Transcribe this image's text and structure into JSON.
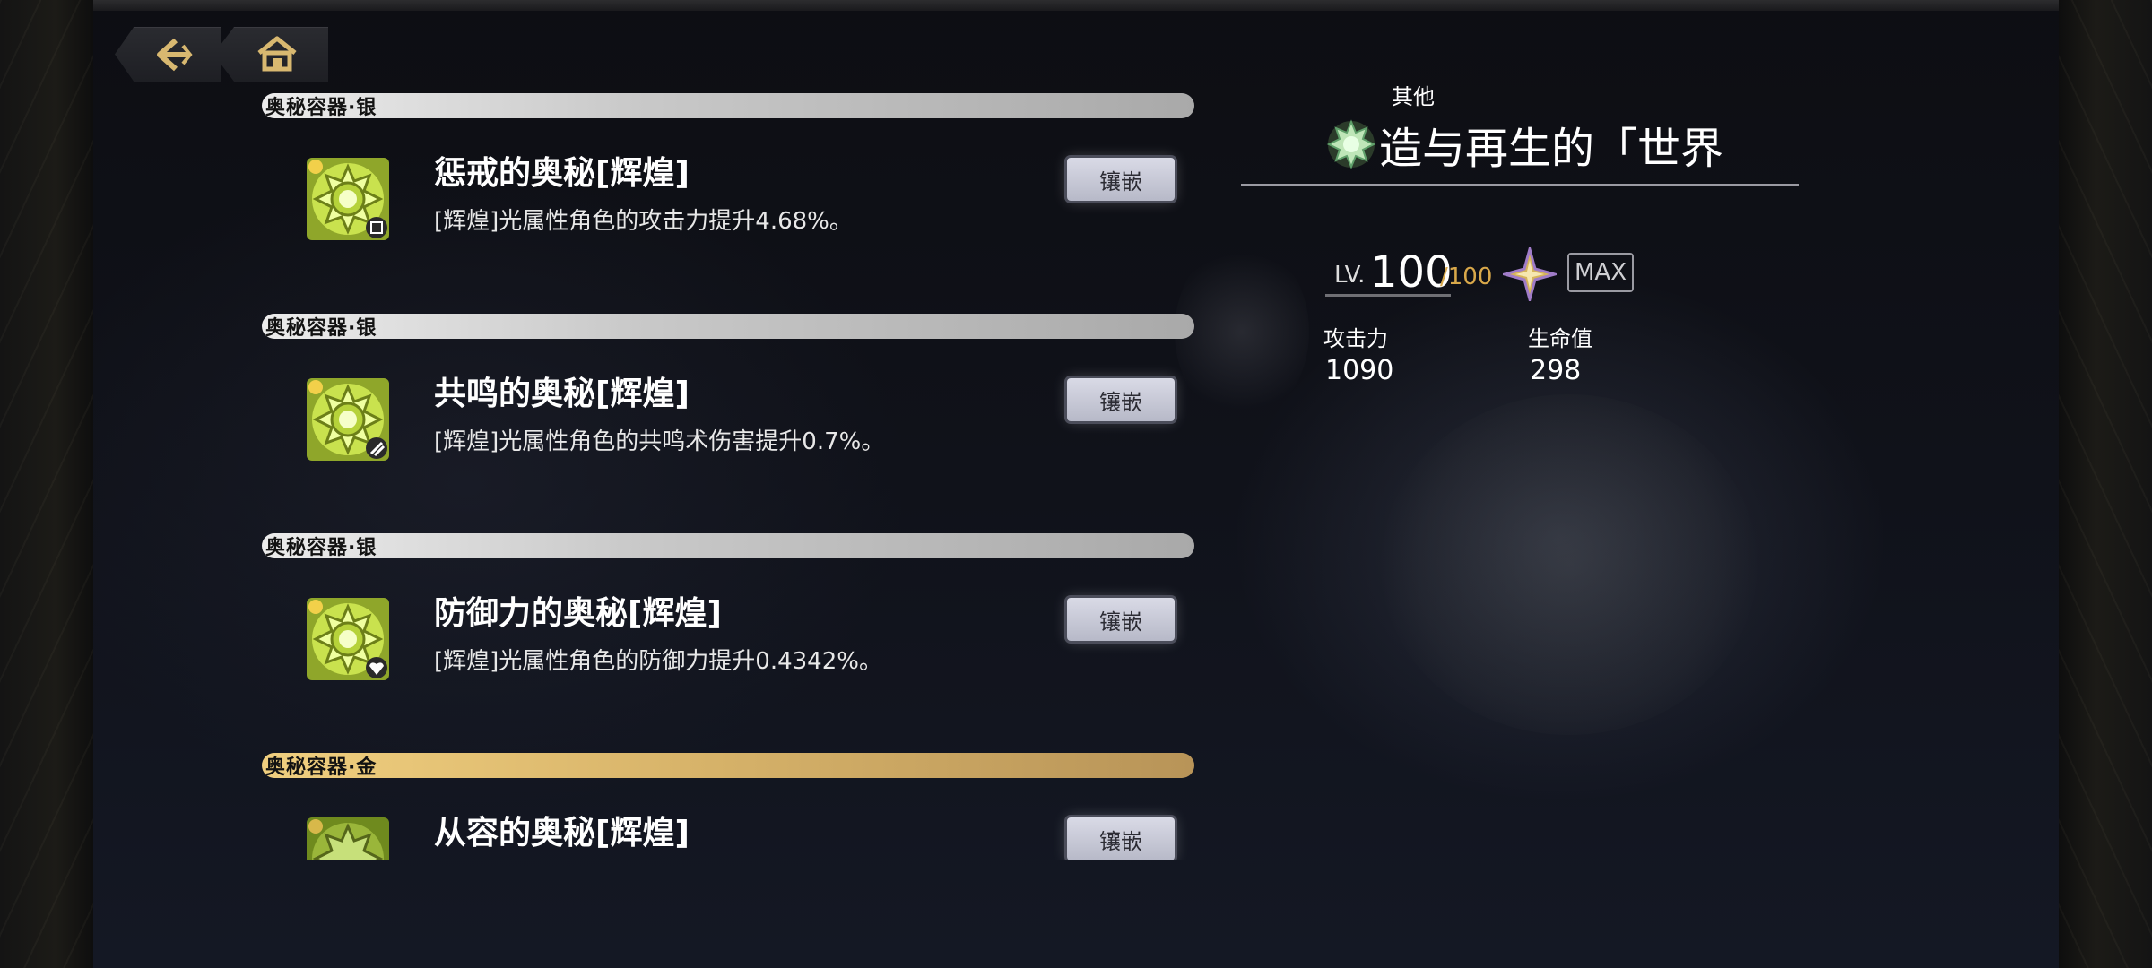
{
  "nav": {
    "back_icon": "back-arrow-icon",
    "home_icon": "home-icon"
  },
  "list": {
    "items": [
      {
        "rarity": "奥秘容器·银",
        "title": "惩戒的奥秘[辉煌]",
        "description": "[辉煌]光属性角色的攻击力提升4.68%。",
        "button": "镶嵌",
        "badge_icon": "attack-badge-icon"
      },
      {
        "rarity": "奥秘容器·银",
        "title": "共鸣的奥秘[辉煌]",
        "description": "[辉煌]光属性角色的共鸣术伤害提升0.7%。",
        "button": "镶嵌",
        "badge_icon": "resonance-badge-icon"
      },
      {
        "rarity": "奥秘容器·银",
        "title": "防御力的奥秘[辉煌]",
        "description": "[辉煌]光属性角色的防御力提升0.4342%。",
        "button": "镶嵌",
        "badge_icon": "defense-badge-icon"
      },
      {
        "rarity": "奥秘容器·金",
        "title": "从容的奥秘[辉煌]",
        "description": "",
        "button": "镶嵌",
        "badge_icon": ""
      }
    ]
  },
  "detail": {
    "category": "其他",
    "title": "造与再生的「世界",
    "level_prefix": "LV.",
    "level": "100",
    "level_max": "/100",
    "max_badge": "MAX",
    "stats": [
      {
        "label": "攻击力",
        "value": "1090"
      },
      {
        "label": "生命值",
        "value": "298"
      }
    ]
  },
  "colors": {
    "silver_bar": "#c9c9c9",
    "gold_bar": "#d8b46a",
    "level_max": "#d9a84a",
    "icon_green": "#b6d23a"
  }
}
